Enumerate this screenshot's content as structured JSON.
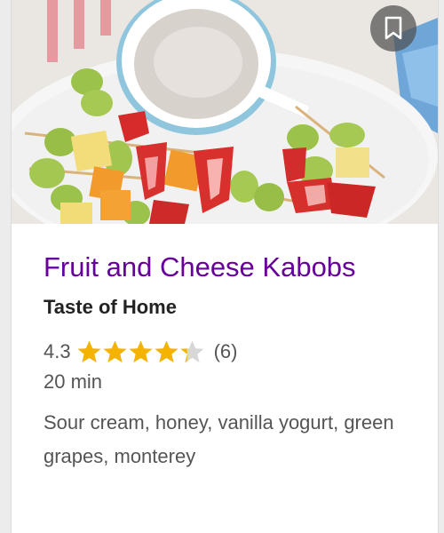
{
  "card": {
    "image_alt": "Fruit and cheese kabobs with dip",
    "save_icon": "bookmark-icon",
    "title": "Fruit and Cheese Kabobs",
    "source": "Taste of Home",
    "rating": {
      "value": "4.3",
      "stars_out_of": 5,
      "star_level": 4.3,
      "count": "(6)"
    },
    "time": "20 min",
    "ingredients": "Sour cream, honey, vanilla yogurt, green grapes, monterey"
  },
  "colors": {
    "title": "#660099",
    "star_filled": "#f5b301",
    "star_empty": "#d7d7d7",
    "source": "#222222",
    "meta": "#555555"
  }
}
